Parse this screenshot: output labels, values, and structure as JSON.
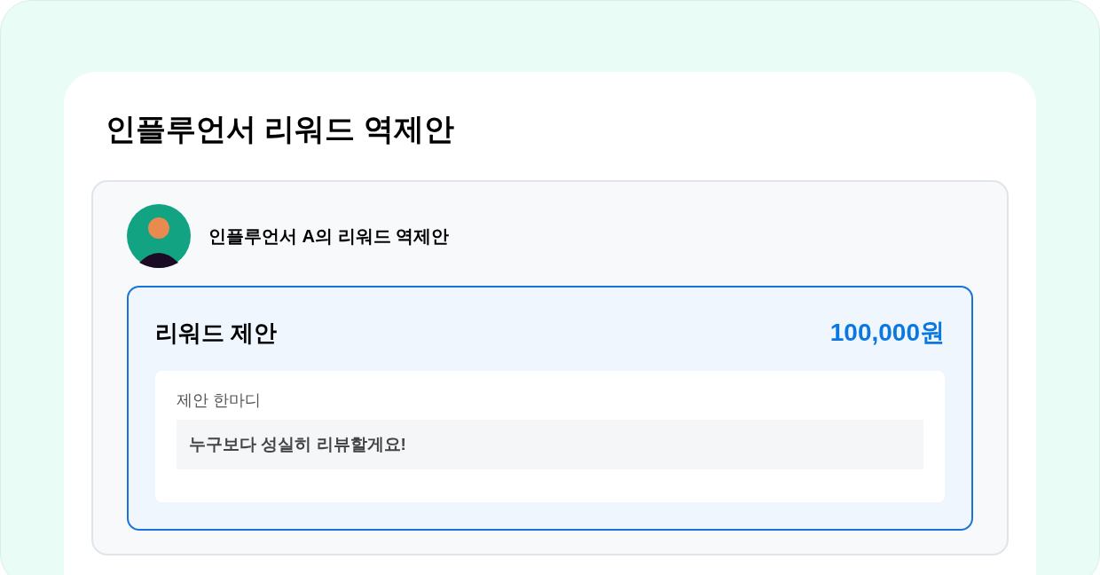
{
  "title": "인플루언서 리워드 역제안",
  "offer": {
    "from": "인플루언서 A의 리워드 역제안",
    "heading": "리워드 제안",
    "amount": "100,000원",
    "message_label": "제안 한마디",
    "message": "누구보다 성실히 리뷰할게요!"
  }
}
